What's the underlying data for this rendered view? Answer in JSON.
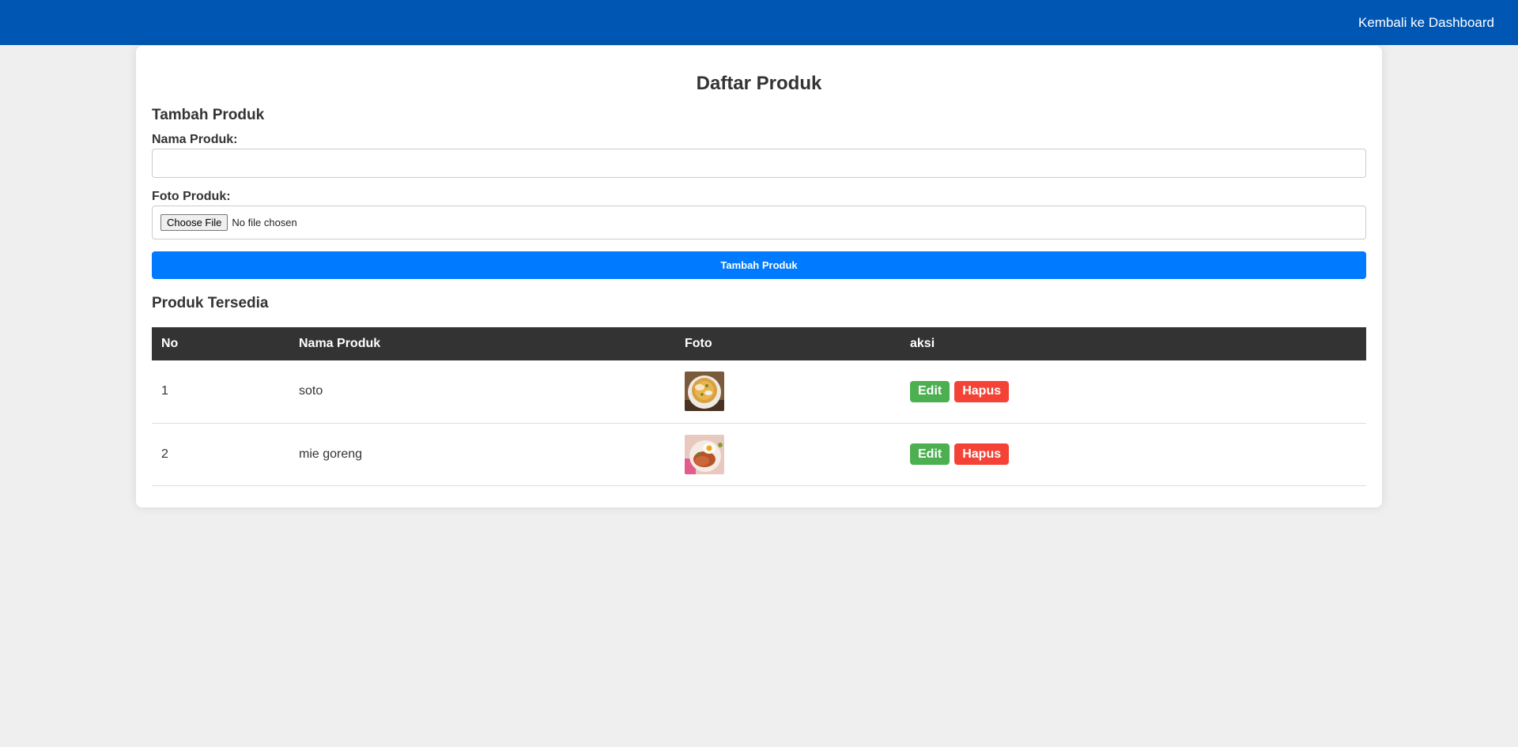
{
  "header": {
    "back_link": "Kembali ke Dashboard",
    "bg_color": "#0056b3"
  },
  "page": {
    "title": "Daftar Produk"
  },
  "form": {
    "section_title": "Tambah Produk",
    "name_label": "Nama Produk:",
    "name_value": "",
    "photo_label": "Foto Produk:",
    "file_button": "Choose File",
    "file_status": "No file chosen",
    "submit_label": "Tambah Produk",
    "submit_color": "#007bff"
  },
  "products": {
    "section_title": "Produk Tersedia",
    "columns": [
      "No",
      "Nama Produk",
      "Foto",
      "aksi"
    ],
    "rows": [
      {
        "no": "1",
        "name": "soto",
        "photo": "soto-bowl-image",
        "edit": "Edit",
        "delete": "Hapus"
      },
      {
        "no": "2",
        "name": "mie goreng",
        "photo": "mie-goreng-plate-image",
        "edit": "Edit",
        "delete": "Hapus"
      }
    ],
    "edit_color": "#4caf50",
    "delete_color": "#f44336"
  }
}
